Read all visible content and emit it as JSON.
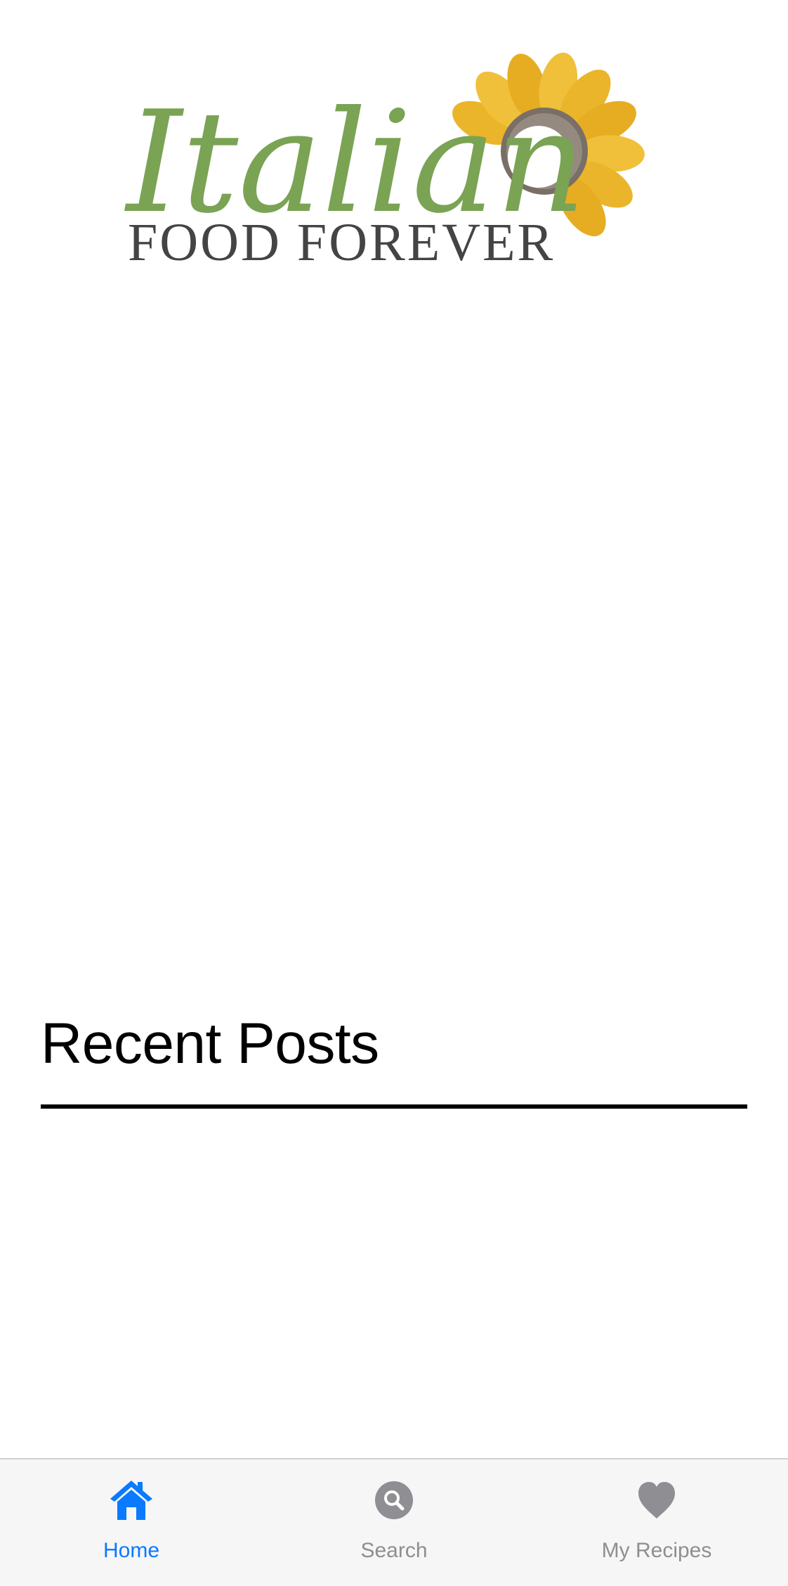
{
  "header": {
    "logo_script": "Italian",
    "logo_sub": "FOOD FOREVER"
  },
  "main": {
    "section_title": "Recent Posts"
  },
  "tabbar": {
    "active_color": "#0a7aff",
    "inactive_color": "#8e8e93",
    "tabs": [
      {
        "label": "Home",
        "icon": "home-icon",
        "active": true
      },
      {
        "label": "Search",
        "icon": "search-icon",
        "active": false
      },
      {
        "label": "My Recipes",
        "icon": "heart-icon",
        "active": false
      }
    ]
  },
  "colors": {
    "logo_green": "#7aa354",
    "logo_gold": "#eab52a",
    "logo_text": "#444444"
  }
}
